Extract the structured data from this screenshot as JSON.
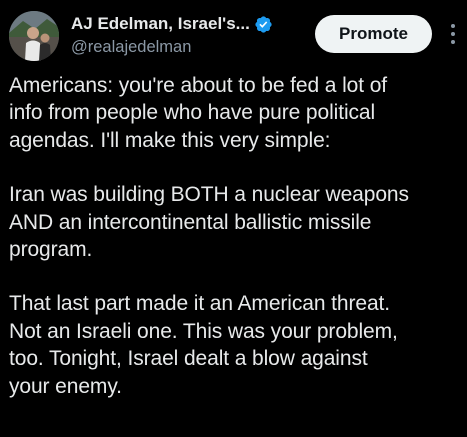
{
  "author": {
    "display_name": "AJ Edelman, Israel's...",
    "handle": "@realajedelman",
    "verified": true,
    "verified_color": "#1d9bf0"
  },
  "actions": {
    "promote_label": "Promote",
    "more_icon": "more-vertical-icon"
  },
  "post": {
    "paragraphs": [
      {
        "lines": [
          "Americans: you're about to be fed a lot of",
          "info from people who have pure political",
          "agendas. I'll make this very simple:"
        ]
      },
      {
        "lines": [
          "Iran was building BOTH a nuclear weapons",
          "AND an intercontinental ballistic missile",
          "program."
        ]
      },
      {
        "lines": [
          "That last part made it an American threat.",
          "Not an Israeli one. This was your problem,",
          "too. Tonight, Israel dealt a blow against",
          "your enemy."
        ]
      }
    ]
  },
  "theme": {
    "background": "#000000",
    "text": "#e7e9ea",
    "secondary_text": "#8b98a5",
    "button_bg": "#eff3f4"
  }
}
